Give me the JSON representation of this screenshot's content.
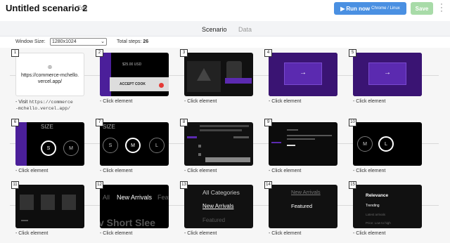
{
  "header": {
    "title": "Untitled scenario 2",
    "edit_label": "Edit",
    "run_label": "Run now",
    "run_sub": "Chrome / Linux",
    "save_label": "Save",
    "run_color": "#4a90e2",
    "save_color": "#a8dba8"
  },
  "tabs": {
    "scenario": "Scenario",
    "data": "Data"
  },
  "controls": {
    "window_size_label": "Window Size:",
    "window_size_value": "1280x1024",
    "total_steps_label": "Total steps:",
    "total_steps_value": "26"
  },
  "steps": [
    {
      "n": "1",
      "action": "Visit",
      "url_line1": "https://commerce",
      "url_line2": "-mchello.vercel.app/",
      "thumb_text": "https://commerce-mchello.vercel.app/"
    },
    {
      "n": "2",
      "action": "Click element",
      "thumb_price": "$25.00 USD",
      "thumb_button": "ACCEPT COOK"
    },
    {
      "n": "3",
      "action": "Click element"
    },
    {
      "n": "4",
      "action": "Click element",
      "thumb_arrow": "→"
    },
    {
      "n": "5",
      "action": "Click element",
      "thumb_arrow": "→"
    },
    {
      "n": "6",
      "action": "Click element",
      "thumb_size": "SIZE",
      "s1": "S",
      "s2": "M"
    },
    {
      "n": "7",
      "action": "Click element",
      "thumb_size": "SIZE",
      "s1": "S",
      "s2": "M",
      "s3": "L"
    },
    {
      "n": "8",
      "action": "Click element"
    },
    {
      "n": "9",
      "action": "Click element"
    },
    {
      "n": "10",
      "action": "Click element",
      "s1": "M",
      "s2": "L"
    },
    {
      "n": "11",
      "action": "Click element"
    },
    {
      "n": "12",
      "action": "Click element",
      "t1": "All",
      "t2": "New Arrivals",
      "t3": "Featu",
      "t4": "v Short Slee"
    },
    {
      "n": "13",
      "action": "Click element",
      "t1": "All Categories",
      "t2": "New Arrivals",
      "t3": "Featured"
    },
    {
      "n": "14",
      "action": "Click element",
      "t1": "New Arrivals",
      "t2": "Featured"
    },
    {
      "n": "15",
      "action": "Click element",
      "t1": "Relevance",
      "t2": "Trending",
      "t3": "Latest arrivals",
      "t4": "Price: Low to high"
    }
  ]
}
